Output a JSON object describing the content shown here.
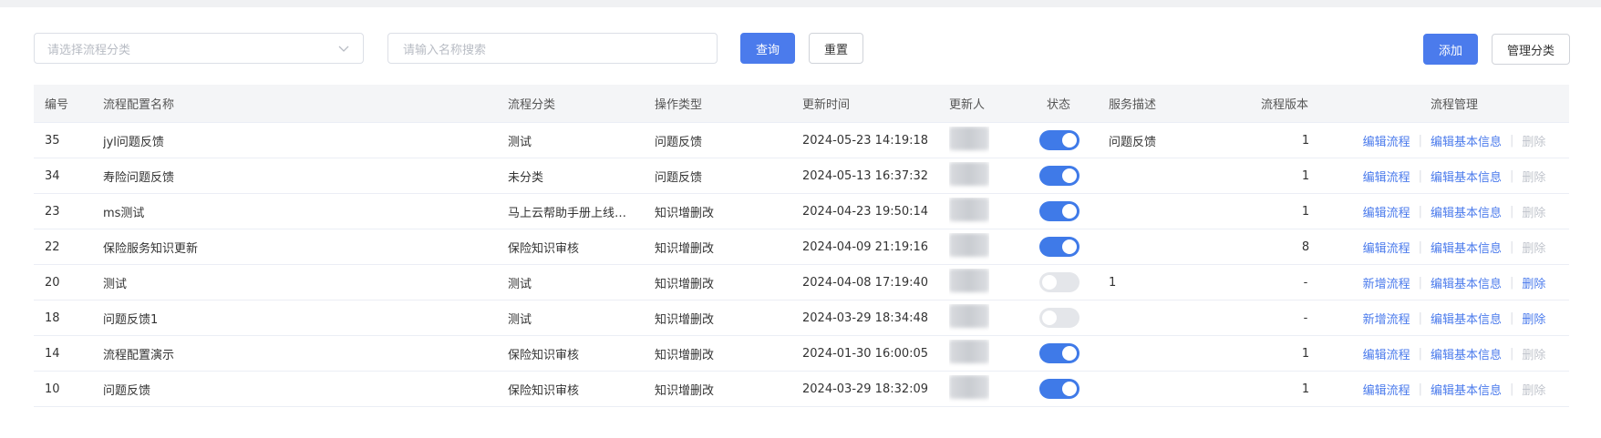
{
  "filters": {
    "category_placeholder": "请选择流程分类",
    "search_placeholder": "请输入名称搜索",
    "query_label": "查询",
    "reset_label": "重置",
    "add_label": "添加",
    "manage_label": "管理分类"
  },
  "table": {
    "headers": {
      "id": "编号",
      "name": "流程配置名称",
      "category": "流程分类",
      "op_type": "操作类型",
      "updated_at": "更新时间",
      "updated_by": "更新人",
      "status": "状态",
      "desc": "服务描述",
      "version": "流程版本",
      "actions": "流程管理"
    },
    "rows": [
      {
        "id": "35",
        "name": "jyl问题反馈",
        "category": "测试",
        "op_type": "问题反馈",
        "updated_at": "2024-05-23 14:19:18",
        "status": true,
        "desc": "问题反馈",
        "version": "1",
        "act1": "编辑流程",
        "act2": "编辑基本信息",
        "act3": "删除",
        "act3_enabled": false
      },
      {
        "id": "34",
        "name": "寿险问题反馈",
        "category": "未分类",
        "op_type": "问题反馈",
        "updated_at": "2024-05-13 16:37:32",
        "status": true,
        "desc": "",
        "version": "1",
        "act1": "编辑流程",
        "act2": "编辑基本信息",
        "act3": "删除",
        "act3_enabled": false
      },
      {
        "id": "23",
        "name": "ms测试",
        "category": "马上云帮助手册上线…",
        "op_type": "知识增删改",
        "updated_at": "2024-04-23 19:50:14",
        "status": true,
        "desc": "",
        "version": "1",
        "act1": "编辑流程",
        "act2": "编辑基本信息",
        "act3": "删除",
        "act3_enabled": false
      },
      {
        "id": "22",
        "name": "保险服务知识更新",
        "category": "保险知识审核",
        "op_type": "知识增删改",
        "updated_at": "2024-04-09 21:19:16",
        "status": true,
        "desc": "",
        "version": "8",
        "act1": "编辑流程",
        "act2": "编辑基本信息",
        "act3": "删除",
        "act3_enabled": false
      },
      {
        "id": "20",
        "name": "测试",
        "category": "测试",
        "op_type": "知识增删改",
        "updated_at": "2024-04-08 17:19:40",
        "status": false,
        "desc": "1",
        "version": "-",
        "act1": "新增流程",
        "act2": "编辑基本信息",
        "act3": "删除",
        "act3_enabled": true
      },
      {
        "id": "18",
        "name": "问题反馈1",
        "category": "测试",
        "op_type": "知识增删改",
        "updated_at": "2024-03-29 18:34:48",
        "status": false,
        "desc": "",
        "version": "-",
        "act1": "新增流程",
        "act2": "编辑基本信息",
        "act3": "删除",
        "act3_enabled": true
      },
      {
        "id": "14",
        "name": "流程配置演示",
        "category": "保险知识审核",
        "op_type": "知识增删改",
        "updated_at": "2024-01-30 16:00:05",
        "status": true,
        "desc": "",
        "version": "1",
        "act1": "编辑流程",
        "act2": "编辑基本信息",
        "act3": "删除",
        "act3_enabled": false
      },
      {
        "id": "10",
        "name": "问题反馈",
        "category": "保险知识审核",
        "op_type": "知识增删改",
        "updated_at": "2024-03-29 18:32:09",
        "status": true,
        "desc": "",
        "version": "1",
        "act1": "编辑流程",
        "act2": "编辑基本信息",
        "act3": "删除",
        "act3_enabled": false
      }
    ]
  },
  "colors": {
    "primary": "#4b7bec",
    "switch_on": "#3f7ae8",
    "disabled_link": "#c0c4cc"
  }
}
